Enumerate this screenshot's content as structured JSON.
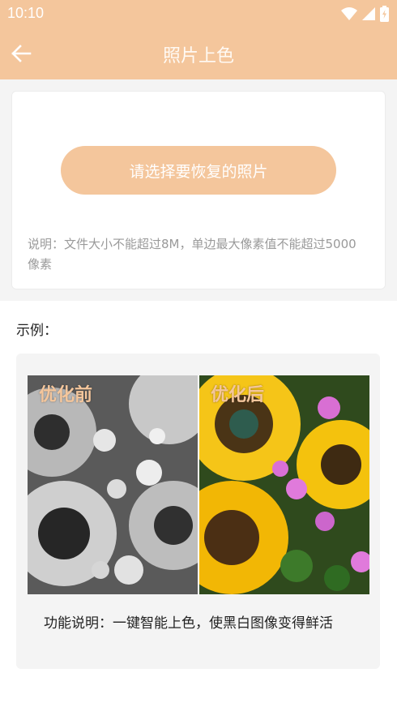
{
  "status_bar": {
    "time": "10:10",
    "icons": [
      "wifi-icon",
      "signal-icon",
      "battery-charging-icon"
    ]
  },
  "toolbar": {
    "title": "照片上色",
    "back_icon": "arrow-left-icon",
    "color": "#f4c69c"
  },
  "upload": {
    "button_label": "请选择要恢复的照片",
    "note": "说明：文件大小不能超过8M，单边最大像素值不能超过5000像素"
  },
  "example": {
    "heading": "示例：",
    "before_label": "优化前",
    "after_label": "优化后",
    "description": "功能说明：一键智能上色，使黑白图像变得鲜活"
  }
}
